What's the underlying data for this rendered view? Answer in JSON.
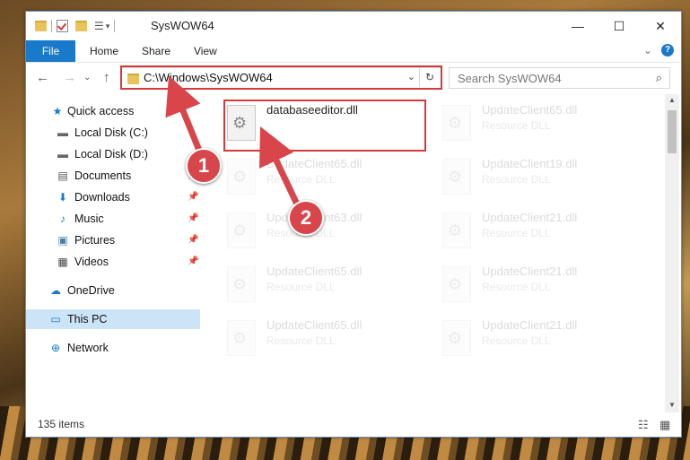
{
  "window": {
    "title": "SysWOW64"
  },
  "quick_access_toolbar": {
    "icons": [
      "folder-icon",
      "properties-check-icon",
      "new-folder-icon",
      "customize-icon",
      "dropdown-icon"
    ]
  },
  "window_controls": {
    "minimize": "—",
    "maximize": "☐",
    "close": "✕"
  },
  "ribbon": {
    "tabs": [
      {
        "label": "File"
      },
      {
        "label": "Home"
      },
      {
        "label": "Share"
      },
      {
        "label": "View"
      }
    ],
    "expand_icon": "⌄",
    "help_icon": "?"
  },
  "nav": {
    "back": "←",
    "forward": "→",
    "history": "⌄",
    "up": "↑"
  },
  "address_bar": {
    "path": "C:\\Windows\\SysWOW64",
    "dropdown": "⌄",
    "refresh": "↻"
  },
  "search": {
    "placeholder": "Search SysWOW64",
    "icon": "⌕"
  },
  "sidebar": {
    "items": [
      {
        "label": "Quick access",
        "icon": "★"
      },
      {
        "label": "Local Disk (C:)",
        "icon": "▬"
      },
      {
        "label": "Local Disk (D:)",
        "icon": "▬"
      },
      {
        "label": "Documents",
        "icon": "▤",
        "pin": "📌"
      },
      {
        "label": "Downloads",
        "icon": "⬇",
        "pin": "📌"
      },
      {
        "label": "Music",
        "icon": "♪",
        "pin": "📌"
      },
      {
        "label": "Pictures",
        "icon": "▣",
        "pin": "📌"
      },
      {
        "label": "Videos",
        "icon": "▦",
        "pin": "📌"
      },
      {
        "label": "OneDrive",
        "icon": "☁"
      },
      {
        "label": "This PC",
        "icon": "▭"
      },
      {
        "label": "Network",
        "icon": "⊕"
      }
    ]
  },
  "files": [
    {
      "name": "databaseeditor.dll",
      "type": ""
    },
    {
      "name": "UpdateClient65.dll",
      "type": "Resource DLL"
    },
    {
      "name": "UpdateClient65.dll",
      "type": "Resource DLL"
    },
    {
      "name": "UpdateClient19.dll",
      "type": "Resource DLL"
    },
    {
      "name": "UpdateClient63.dll",
      "type": "Resource DLL"
    },
    {
      "name": "UpdateClient21.dll",
      "type": "Resource DLL"
    },
    {
      "name": "UpdateClient65.dll",
      "type": "Resource DLL"
    },
    {
      "name": "UpdateClient21.dll",
      "type": "Resource DLL"
    },
    {
      "name": "UpdateClient65.dll",
      "type": "Resource DLL"
    },
    {
      "name": "UpdateClient21.dll",
      "type": "Resource DLL"
    }
  ],
  "scrollbar": {
    "up": "▲",
    "down": "▼"
  },
  "status": {
    "count": "135 items",
    "details_view": "☷",
    "large_icons_view": "▦"
  },
  "markers": [
    {
      "label": "1"
    },
    {
      "label": "2"
    }
  ],
  "colors": {
    "accent": "#1979ca",
    "highlight": "#d43a3a",
    "selected": "#cce4f7"
  }
}
